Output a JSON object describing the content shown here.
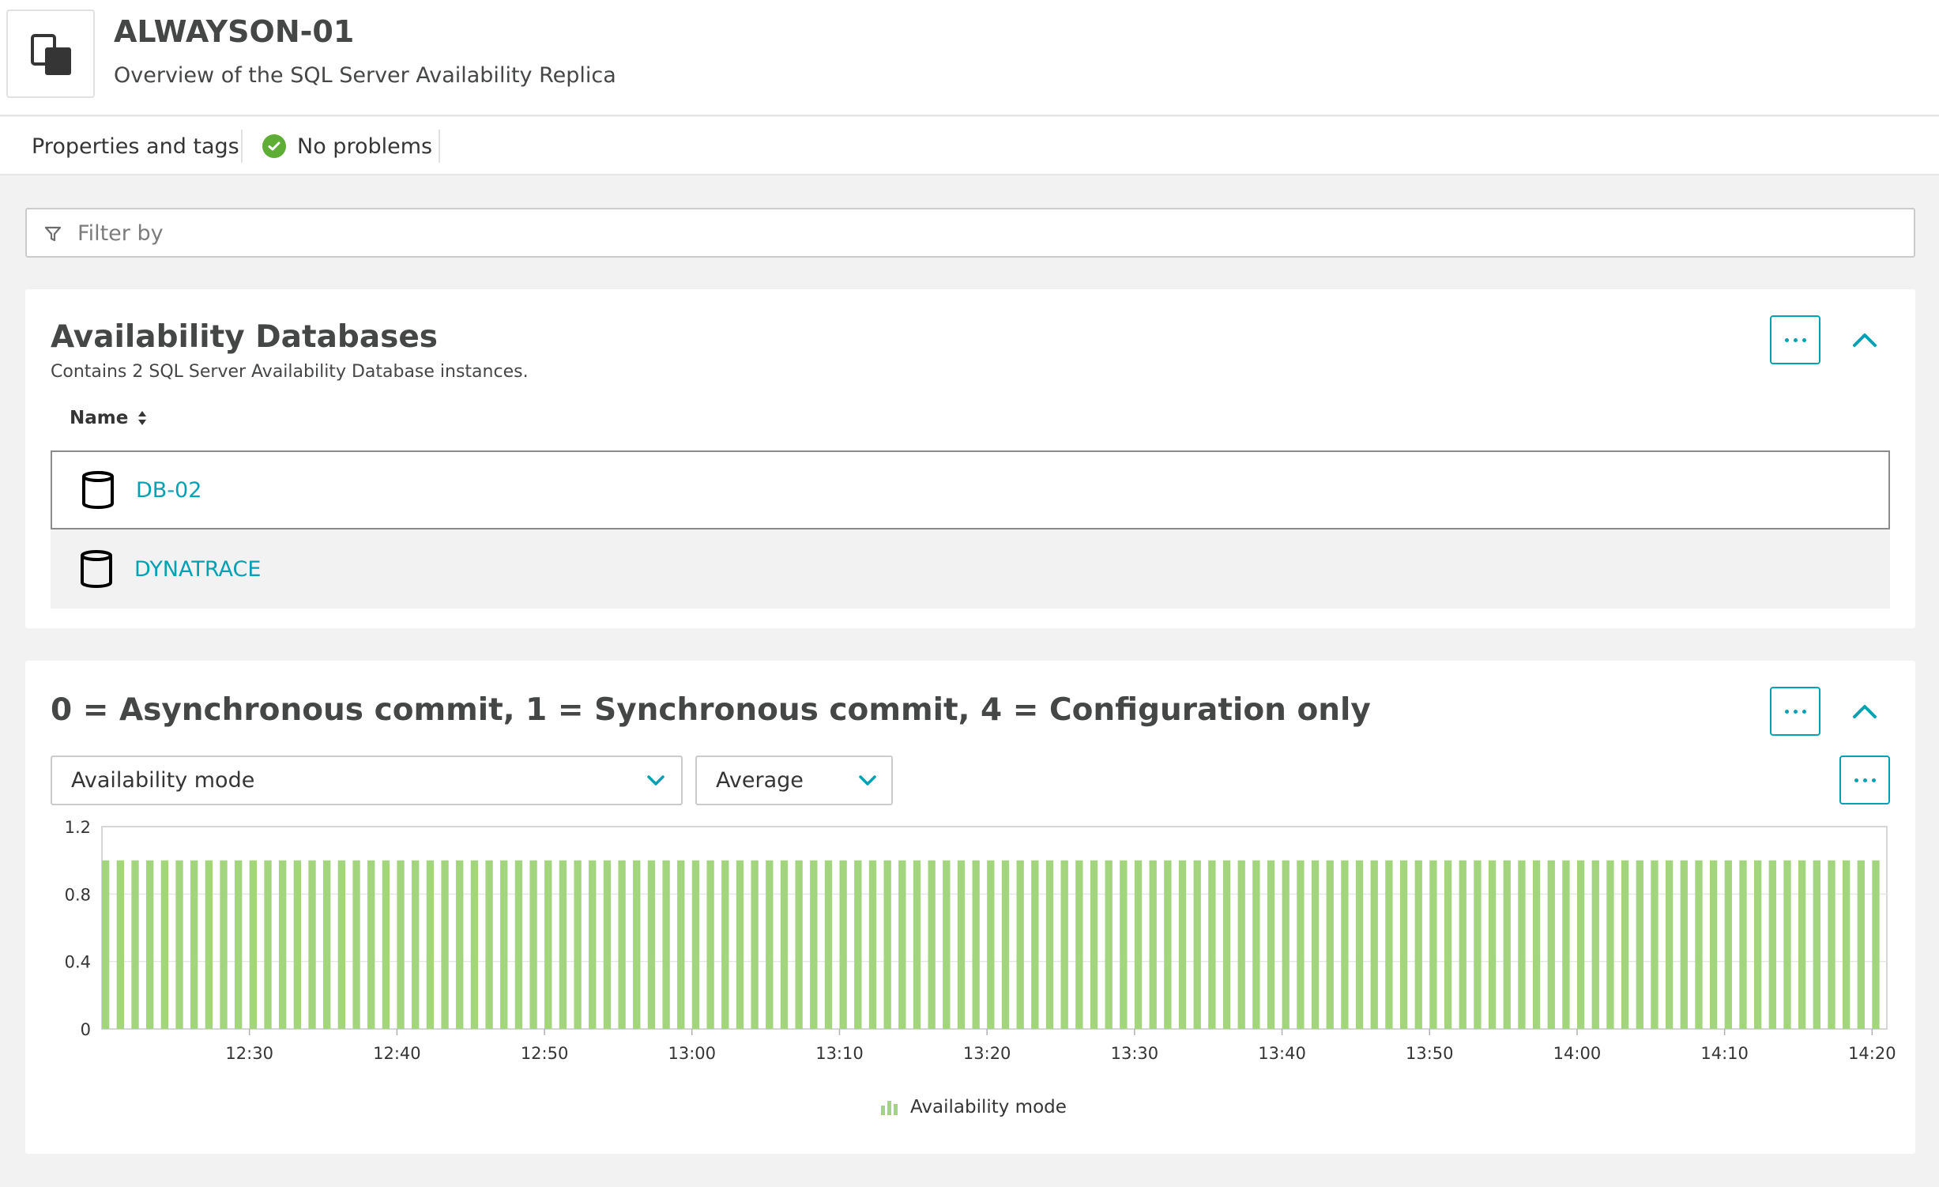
{
  "header": {
    "title": "ALWAYSON-01",
    "subtitle": "Overview of the SQL Server Availability Replica",
    "icon": "replica-icon"
  },
  "tabs": {
    "properties_label": "Properties and tags",
    "problems_label": "No problems",
    "problems_icon": "check-circle-icon"
  },
  "filter": {
    "placeholder": "Filter by",
    "icon": "filter-icon"
  },
  "databases_card": {
    "title": "Availability Databases",
    "description": "Contains 2 SQL Server Availability Database instances.",
    "column_header": "Name",
    "rows": [
      {
        "name": "DB-02",
        "icon": "database-icon"
      },
      {
        "name": "DYNATRACE",
        "icon": "database-icon"
      }
    ]
  },
  "chart_card": {
    "title": "0 = Asynchronous commit, 1 = Synchronous commit, 4 = Configuration only",
    "metric_select": "Availability mode",
    "aggregation_select": "Average",
    "legend_label": "Availability mode"
  },
  "colors": {
    "accent": "#00a1b2",
    "bar": "#a3d57e",
    "ok": "#5ead35"
  },
  "chart_data": {
    "type": "bar",
    "x_ticks": [
      "12:30",
      "12:40",
      "12:50",
      "13:00",
      "13:10",
      "13:20",
      "13:30",
      "13:40",
      "13:50",
      "14:00",
      "14:10",
      "14:20"
    ],
    "y_ticks": [
      "1.2",
      "0.8",
      "0.4",
      "0"
    ],
    "ylim": [
      0,
      1.2
    ],
    "x_range": [
      "12:20",
      "14:21"
    ],
    "interval_minutes": 1,
    "bar_count": 121,
    "series": [
      {
        "name": "Availability mode",
        "value_all_bars": 1
      }
    ],
    "grid": true,
    "legend_position": "bottom-center"
  }
}
